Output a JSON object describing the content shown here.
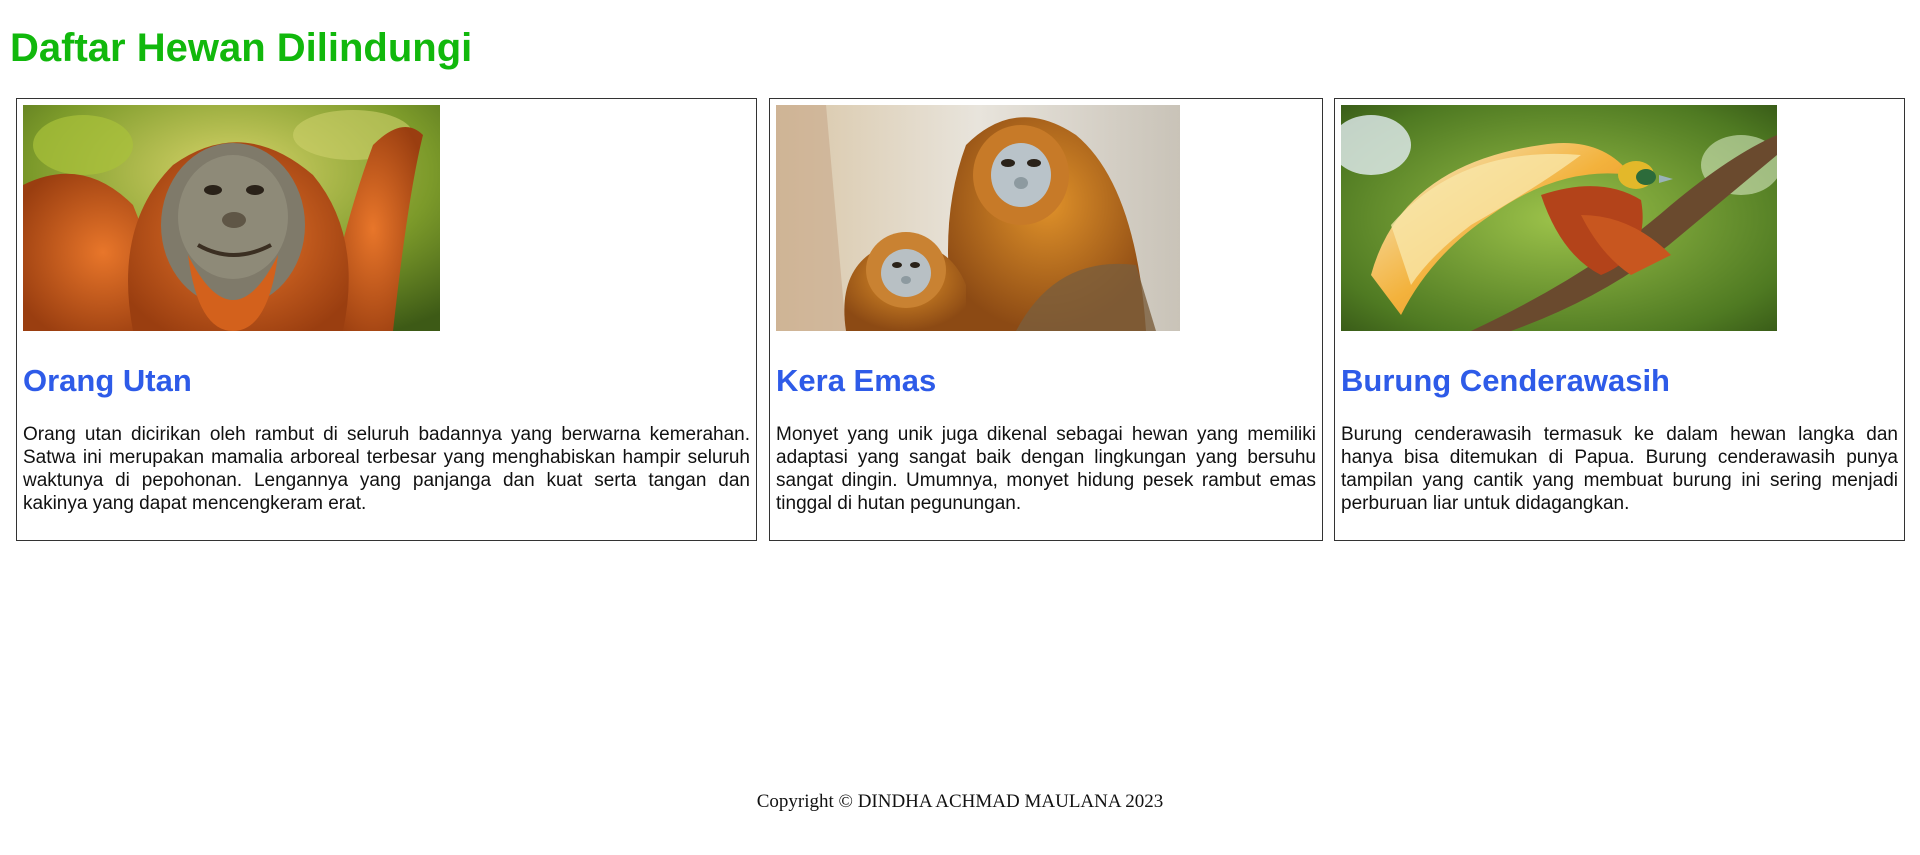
{
  "page": {
    "title": "Daftar Hewan Dilindungi",
    "title_color": "#11b80c",
    "heading_color": "#2e5be8"
  },
  "cards": [
    {
      "title": "Orang Utan",
      "image_alt": "orangutan",
      "description": "Orang utan dicirikan oleh rambut di seluruh badannya yang berwarna kemerahan. Satwa ini merupakan mamalia arboreal terbesar yang menghabiskan hampir seluruh waktunya di pepohonan. Lengannya yang panjanga dan kuat serta tangan dan kakinya yang dapat mencengkeram erat."
    },
    {
      "title": "Kera Emas",
      "image_alt": "golden snub-nosed monkey",
      "description": "Monyet yang unik juga dikenal sebagai hewan yang memiliki adaptasi yang sangat baik dengan lingkungan yang bersuhu sangat dingin. Umumnya, monyet hidung pesek rambut emas tinggal di hutan pegunungan."
    },
    {
      "title": "Burung Cenderawasih",
      "image_alt": "bird of paradise",
      "description": "Burung cenderawasih termasuk ke dalam hewan langka dan hanya bisa ditemukan di Papua. Burung cenderawasih punya tampilan yang cantik yang membuat burung ini sering menjadi perburuan liar untuk didagangkan."
    }
  ],
  "footer": {
    "text": "Copyright © DINDHA ACHMAD MAULANA 2023"
  }
}
